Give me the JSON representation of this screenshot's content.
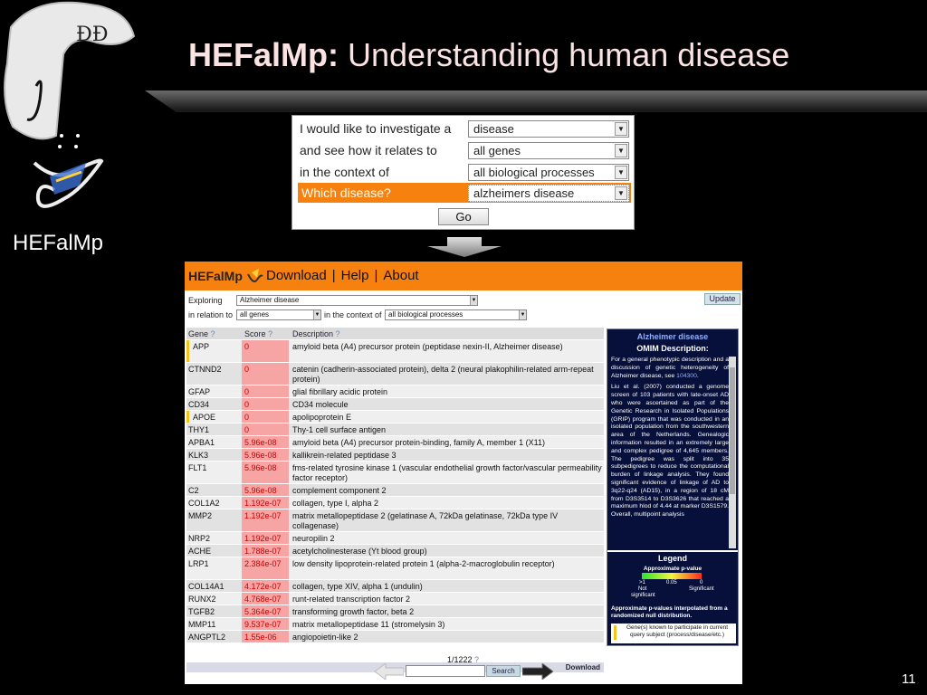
{
  "slide": {
    "title_bold": "HEFalMp:",
    "title_rest": " Understanding human disease",
    "logo_caption": "HEFalMp",
    "page_number": "11"
  },
  "query_form": {
    "rows": [
      {
        "label": "I would like to investigate a",
        "value": "disease"
      },
      {
        "label": "and see how it relates to",
        "value": "all genes"
      },
      {
        "label": "in the context of",
        "value": "all biological processes"
      },
      {
        "label": "Which disease?",
        "value": "alzheimers disease"
      }
    ],
    "go_label": "Go"
  },
  "app": {
    "brand": "HEFalMp",
    "nav": {
      "download": "Download",
      "help": "Help",
      "about": "About"
    },
    "controls": {
      "exploring_label": "Exploring",
      "exploring_value": "Alzheimer disease",
      "relation_label": "in relation to",
      "relation_value": "all genes",
      "context_label": "in the context of",
      "context_value": "all biological processes",
      "update_label": "Update"
    },
    "table": {
      "headers": {
        "gene": "Gene",
        "score": "Score",
        "description": "Description",
        "help": "?"
      },
      "rows": [
        {
          "gene": "APP",
          "score": "0",
          "desc": "amyloid beta (A4) precursor protein (peptidase nexin-II, Alzheimer disease)",
          "known": true
        },
        {
          "gene": "CTNND2",
          "score": "0",
          "desc": "catenin (cadherin-associated protein), delta 2 (neural plakophilin-related arm-repeat protein)",
          "known": false
        },
        {
          "gene": "GFAP",
          "score": "0",
          "desc": "glial fibrillary acidic protein",
          "known": false
        },
        {
          "gene": "CD34",
          "score": "0",
          "desc": "CD34 molecule",
          "known": false
        },
        {
          "gene": "APOE",
          "score": "0",
          "desc": "apolipoprotein E",
          "known": true
        },
        {
          "gene": "THY1",
          "score": "0",
          "desc": "Thy-1 cell surface antigen",
          "known": false
        },
        {
          "gene": "APBA1",
          "score": "5.96e-08",
          "desc": "amyloid beta (A4) precursor protein-binding, family A, member 1 (X11)",
          "known": false
        },
        {
          "gene": "KLK3",
          "score": "5.96e-08",
          "desc": "kallikrein-related peptidase 3",
          "known": false
        },
        {
          "gene": "FLT1",
          "score": "5.96e-08",
          "desc": "fms-related tyrosine kinase 1 (vascular endothelial growth factor/vascular permeability factor receptor)",
          "known": false
        },
        {
          "gene": "C2",
          "score": "5.96e-08",
          "desc": "complement component 2",
          "known": false
        },
        {
          "gene": "COL1A2",
          "score": "1.192e-07",
          "desc": "collagen, type I, alpha 2",
          "known": false
        },
        {
          "gene": "MMP2",
          "score": "1.192e-07",
          "desc": "matrix metallopeptidase 2 (gelatinase A, 72kDa gelatinase, 72kDa type IV collagenase)",
          "known": false
        },
        {
          "gene": "NRP2",
          "score": "1.192e-07",
          "desc": "neuropilin 2",
          "known": false
        },
        {
          "gene": "ACHE",
          "score": "1.788e-07",
          "desc": "acetylcholinesterase (Yt blood group)",
          "known": false
        },
        {
          "gene": "LRP1",
          "score": "2.384e-07",
          "desc": "low density lipoprotein-related protein 1 (alpha-2-macroglobulin receptor)",
          "known": false
        },
        {
          "gene": "COL14A1",
          "score": "4.172e-07",
          "desc": "collagen, type XIV, alpha 1 (undulin)",
          "known": false
        },
        {
          "gene": "RUNX2",
          "score": "4.768e-07",
          "desc": "runt-related transcription factor 2",
          "known": false
        },
        {
          "gene": "TGFB2",
          "score": "5.364e-07",
          "desc": "transforming growth factor, beta 2",
          "known": false
        },
        {
          "gene": "MMP11",
          "score": "9.537e-07",
          "desc": "matrix metallopeptidase 11 (stromelysin 3)",
          "known": false
        },
        {
          "gene": "ANGPTL2",
          "score": "1.55e-06",
          "desc": "angiopoietin-like 2",
          "known": false
        }
      ],
      "download_label": "Download"
    },
    "side_panel": {
      "title": "Alzheimer disease",
      "subtitle": "OMIM Description:",
      "para1_a": "For a general phenotypic description and a discussion of genetic heterogeneity of Alzheimer disease, see ",
      "para1_link": "104300",
      "para1_b": ".",
      "para2": "Liu et al. (2007) conducted a genome screen of 103 patients with late-onset AD who were ascertained as part of the Genetic Research in Isolated Populations (GRIP) program that was conducted in an isolated population from the southwestern area of the Netherlands. Genealogic information resulted in an extremely large and complex pedigree of 4,645 members. The pedigree was split into 35 subpedigrees to reduce the computational burden of linkage analysis. They found significant evidence of linkage of AD to 3q22-q24 (AD15), in a region of 18 cM from D3S3514 to D3S3626 that reached a maximum hlod of 4.44 at marker D3S1579. Overall, multipoint analysis"
    },
    "legend": {
      "title": "Legend",
      "subtitle": "Approximate p-value",
      "tick_left": ">1",
      "tick_mid": "0.05",
      "tick_right": "0",
      "left_label_1": "Not",
      "left_label_2": "significant",
      "right_label": "Significant",
      "note": "Approximate p-values interpolated from a randomized null distribution.",
      "known_text": "Gene(s) known to participate in current query subject (process/disease/etc.)",
      "colors": {
        "low": "#27e62d",
        "mid": "#f4f43c",
        "high": "#ff2a1a",
        "known": "#f3c31b"
      }
    },
    "pager": {
      "count": "1/1222",
      "help": "?",
      "search_label": "Search"
    }
  }
}
